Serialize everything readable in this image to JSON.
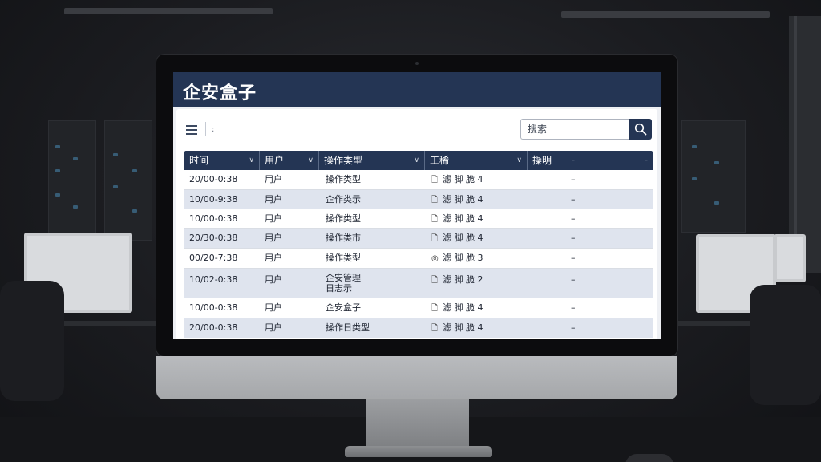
{
  "app": {
    "title": "企安盒子"
  },
  "toolbar": {
    "separator_glyph": ":",
    "search_placeholder": "搜索"
  },
  "table": {
    "headers": [
      "时间",
      "用户",
      "操作类型",
      "工稀",
      "操明",
      ""
    ],
    "rows": [
      {
        "time": "20/00-0:38",
        "user": "用户",
        "op": "操作类型",
        "op2": "",
        "icon": "document-icon",
        "icon_glyph": "🗋",
        "detail": "滤 脚 脆 4",
        "dash": "–"
      },
      {
        "time": "10/00-9:38",
        "user": "用户",
        "op": "企作类示",
        "op2": "",
        "icon": "document-icon",
        "icon_glyph": "🗋",
        "detail": "滤 脚 脆 4",
        "dash": "–"
      },
      {
        "time": "10/00-0:38",
        "user": "用户",
        "op": "操作类型",
        "op2": "",
        "icon": "document-icon",
        "icon_glyph": "🗋",
        "detail": "滤 脚 脆 4",
        "dash": "–"
      },
      {
        "time": "20/30-0:38",
        "user": "用户",
        "op": "操作类市",
        "op2": "",
        "icon": "document-icon",
        "icon_glyph": "🗋",
        "detail": "滤 脚 脆 4",
        "dash": "–"
      },
      {
        "time": "00/20-7:38",
        "user": "用户",
        "op": "操作类型",
        "op2": "",
        "icon": "target-icon",
        "icon_glyph": "◎",
        "detail": "滤 脚 脆 3",
        "dash": "–"
      },
      {
        "time": "10/02-0:38",
        "user": "用户",
        "op": "企安管理",
        "op2": "日志示",
        "icon": "document-icon",
        "icon_glyph": "🗋",
        "detail": "滤 脚 脆 2",
        "dash": "–"
      },
      {
        "time": "10/00-0:38",
        "user": "用户",
        "op": "企安盒子",
        "op2": "",
        "icon": "document-icon",
        "icon_glyph": "🗋",
        "detail": "滤 脚 脆 4",
        "dash": "–"
      },
      {
        "time": "20/00-0:38",
        "user": "用户",
        "op": "操作日类型",
        "op2": "",
        "icon": "document-icon",
        "icon_glyph": "🗋",
        "detail": "滤 脚 脆 4",
        "dash": "–"
      }
    ]
  },
  "colors": {
    "header_navy": "#243554",
    "row_alt": "#dfe4ee",
    "background_room": "#1b1c20"
  }
}
